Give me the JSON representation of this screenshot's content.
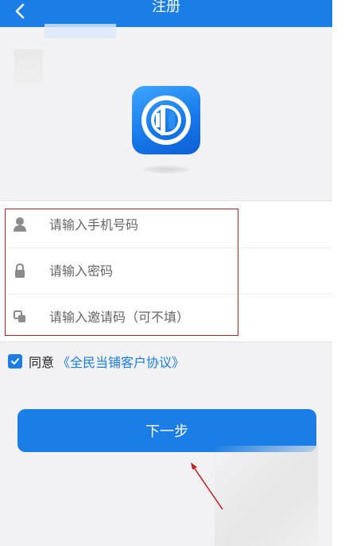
{
  "header": {
    "title": "注册",
    "back_icon": "chevron-left-icon",
    "background": "#1a7ee6"
  },
  "logo": {
    "icon": "app-logo-icon"
  },
  "form": {
    "phone": {
      "icon": "person-icon",
      "placeholder": "请输入手机号码"
    },
    "password": {
      "icon": "lock-icon",
      "placeholder": "请输入密码"
    },
    "invite": {
      "icon": "invite-code-icon",
      "placeholder": "请输入邀请码（可不填）"
    }
  },
  "agreement": {
    "checked": true,
    "prefix": "同意",
    "link_text": "《全民当铺客户协议》"
  },
  "next_button": {
    "label": "下一步"
  },
  "colors": {
    "accent": "#1a7ee6",
    "annotation": "#c81e1e"
  }
}
